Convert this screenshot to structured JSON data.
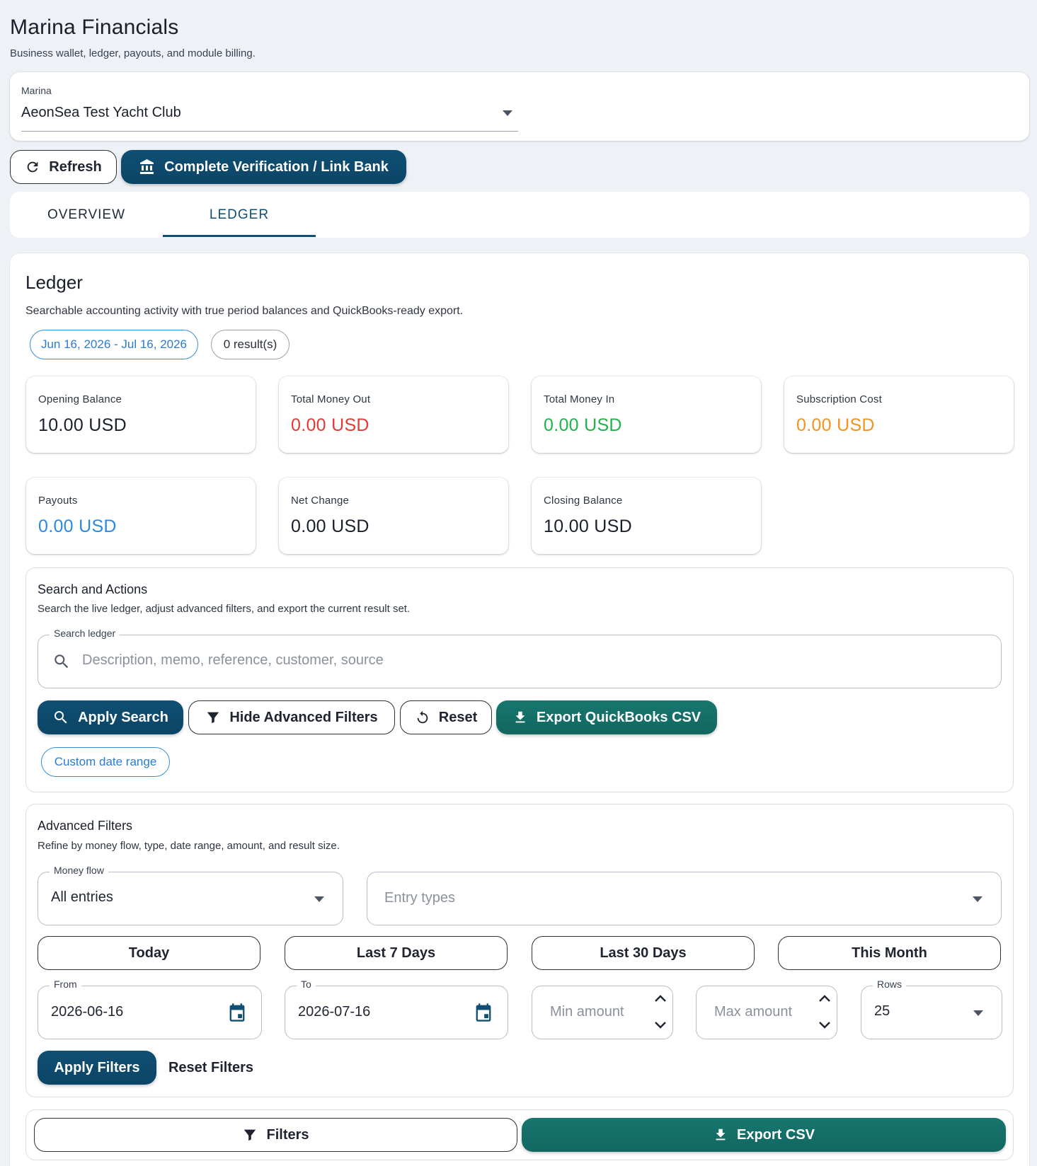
{
  "header": {
    "title": "Marina Financials",
    "subtitle": "Business wallet, ledger, payouts, and module billing."
  },
  "marina_selector": {
    "label": "Marina",
    "value": "AeonSea Test Yacht Club"
  },
  "actions": {
    "refresh_label": "Refresh",
    "verify_label": "Complete Verification / Link Bank"
  },
  "tabs": [
    {
      "label": "OVERVIEW",
      "active": false
    },
    {
      "label": "LEDGER",
      "active": true
    }
  ],
  "ledger": {
    "title": "Ledger",
    "description": "Searchable accounting activity with true period balances and QuickBooks-ready export.",
    "date_range_chip": "Jun 16, 2026 - Jul 16, 2026",
    "results_chip": "0 result(s)",
    "stats": [
      {
        "label": "Opening Balance",
        "value": "10.00 USD",
        "color": "#1a1f2b"
      },
      {
        "label": "Total Money Out",
        "value": "0.00 USD",
        "color": "#e53935"
      },
      {
        "label": "Total Money In",
        "value": "0.00 USD",
        "color": "#1fb34a"
      },
      {
        "label": "Subscription Cost",
        "value": "0.00 USD",
        "color": "#f29420"
      },
      {
        "label": "Payouts",
        "value": "0.00 USD",
        "color": "#2b8ae0"
      },
      {
        "label": "Net Change",
        "value": "0.00 USD",
        "color": "#1a1f2b"
      },
      {
        "label": "Closing Balance",
        "value": "10.00 USD",
        "color": "#1a1f2b"
      }
    ]
  },
  "search_section": {
    "title": "Search and Actions",
    "description": "Search the live ledger, adjust advanced filters, and export the current result set.",
    "search_label": "Search ledger",
    "search_placeholder": "Description, memo, reference, customer, source",
    "apply_search_label": "Apply Search",
    "hide_filters_label": "Hide Advanced Filters",
    "reset_label": "Reset",
    "export_qb_label": "Export QuickBooks CSV",
    "custom_range_chip": "Custom date range"
  },
  "advanced_filters": {
    "title": "Advanced Filters",
    "description": "Refine by money flow, type, date range, amount, and result size.",
    "money_flow_label": "Money flow",
    "money_flow_value": "All entries",
    "entry_types_placeholder": "Entry types",
    "presets": [
      "Today",
      "Last 7 Days",
      "Last 30 Days",
      "This Month"
    ],
    "from_label": "From",
    "from_value": "2026-06-16",
    "to_label": "To",
    "to_value": "2026-07-16",
    "min_amount_placeholder": "Min amount",
    "max_amount_placeholder": "Max amount",
    "rows_label": "Rows",
    "rows_value": "25",
    "apply_filters_label": "Apply Filters",
    "reset_filters_label": "Reset Filters"
  },
  "bottom_bar": {
    "filters_label": "Filters",
    "export_csv_label": "Export CSV"
  },
  "icons": {
    "refresh": "refresh-icon",
    "bank": "bank-icon",
    "search": "search-icon",
    "filter": "filter-icon",
    "reset": "reset-icon",
    "download": "download-icon",
    "calendar": "calendar-icon",
    "dropdown": "chevron-down-icon"
  },
  "colors": {
    "primary": "#0f4f73",
    "export": "#17766e",
    "chip_blue": "#2b7bd0",
    "money_out": "#e53935",
    "money_in": "#1fb34a",
    "subscription": "#f29420",
    "payouts": "#2b8ae0"
  }
}
